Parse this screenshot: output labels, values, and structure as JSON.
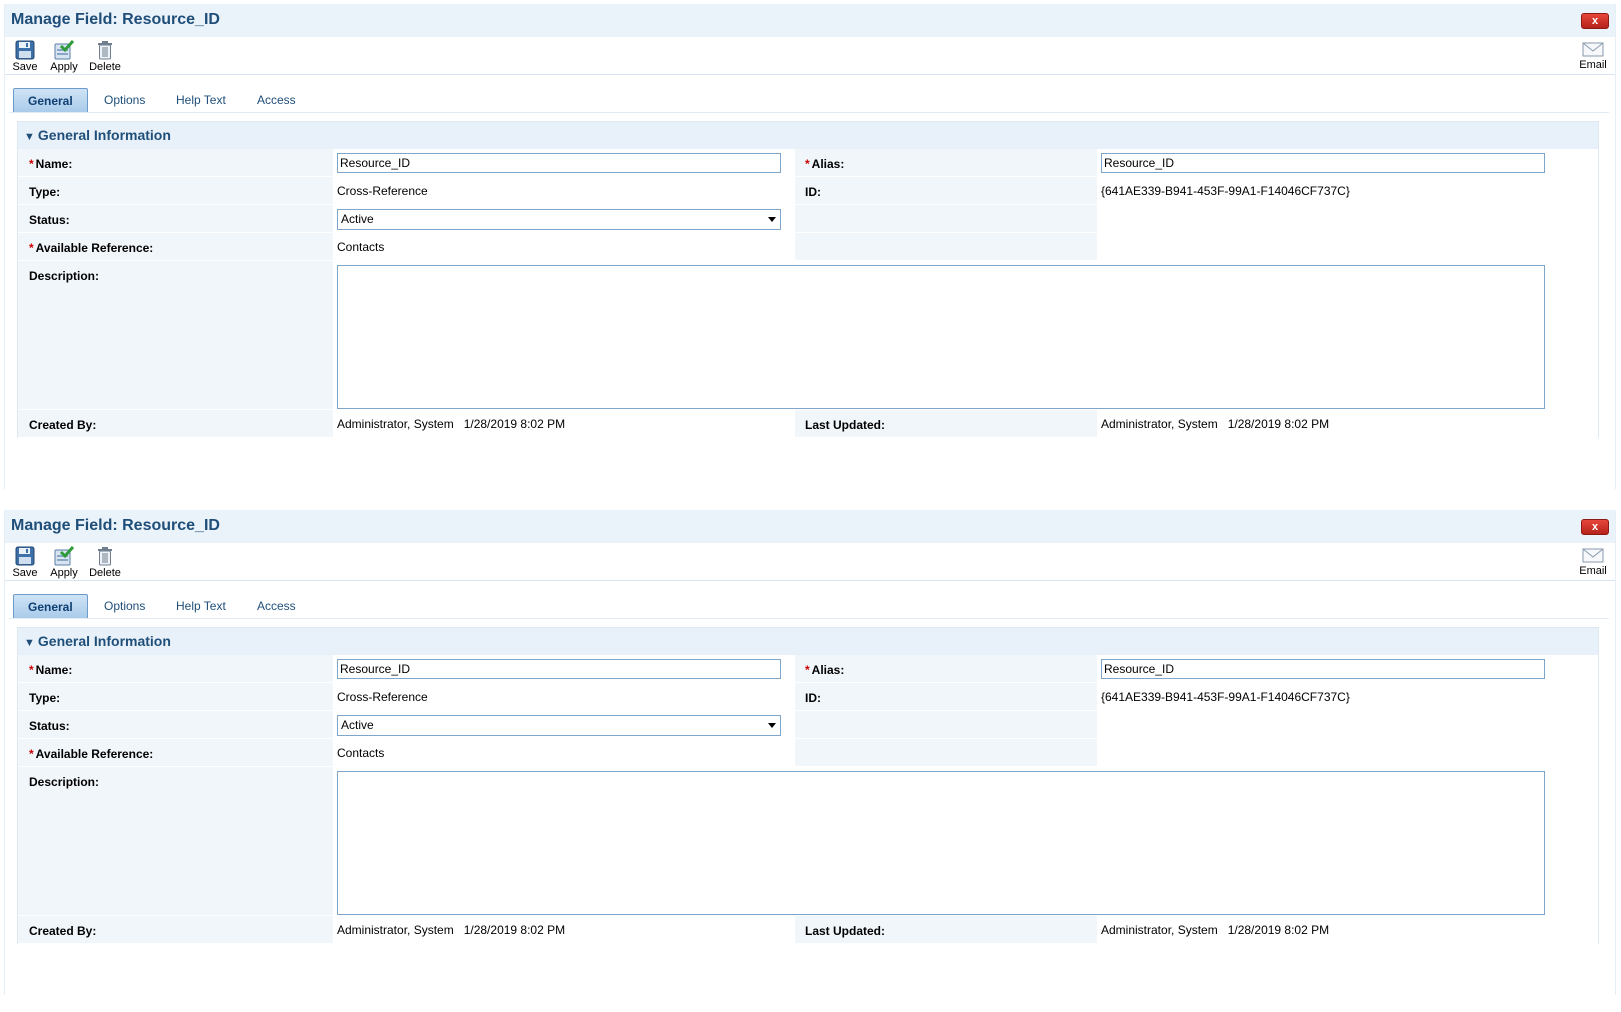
{
  "panels": [
    {
      "title": "Manage Field: Resource_ID",
      "close_label": "x",
      "toolbar": {
        "save": "Save",
        "apply": "Apply",
        "delete": "Delete",
        "email": "Email"
      },
      "tabs": [
        "General",
        "Options",
        "Help Text",
        "Access"
      ],
      "active_tab": "General",
      "section_title": "General Information",
      "fields": {
        "name_label": "Name:",
        "name_value": "Resource_ID",
        "alias_label": "Alias:",
        "alias_value": "Resource_ID",
        "type_label": "Type:",
        "type_value": "Cross-Reference",
        "id_label": "ID:",
        "id_value": "{641AE339-B941-453F-99A1-F14046CF737C}",
        "status_label": "Status:",
        "status_value": "Active",
        "available_reference_label": "Available Reference:",
        "available_reference_value": "Contacts",
        "description_label": "Description:",
        "description_value": "",
        "created_by_label": "Created By:",
        "created_by_value": "Administrator, System   1/28/2019 8:02 PM",
        "last_updated_label": "Last Updated:",
        "last_updated_value": "Administrator, System   1/28/2019 8:02 PM"
      }
    },
    {
      "title": "Manage Field: Resource_ID",
      "close_label": "x",
      "toolbar": {
        "save": "Save",
        "apply": "Apply",
        "delete": "Delete",
        "email": "Email"
      },
      "tabs": [
        "General",
        "Options",
        "Help Text",
        "Access"
      ],
      "active_tab": "General",
      "section_title": "General Information",
      "fields": {
        "name_label": "Name:",
        "name_value": "Resource_ID",
        "alias_label": "Alias:",
        "alias_value": "Resource_ID",
        "type_label": "Type:",
        "type_value": "Cross-Reference",
        "id_label": "ID:",
        "id_value": "{641AE339-B941-453F-99A1-F14046CF737C}",
        "status_label": "Status:",
        "status_value": "Active",
        "available_reference_label": "Available Reference:",
        "available_reference_value": "Contacts",
        "description_label": "Description:",
        "description_value": "",
        "created_by_label": "Created By:",
        "created_by_value": "Administrator, System   1/28/2019 8:02 PM",
        "last_updated_label": "Last Updated:",
        "last_updated_value": "Administrator, System   1/28/2019 8:02 PM"
      }
    }
  ],
  "colors": {
    "title": "#1f4e79",
    "header_bg": "#eaf2fa",
    "label_bg": "#f1f6fb",
    "required": "#cc0000",
    "input_border": "#7ea6cc"
  },
  "icons": {
    "save": "floppy-disk-icon",
    "apply": "apply-check-icon",
    "delete": "trash-can-icon",
    "email": "envelope-icon",
    "close": "close-icon",
    "collapse": "triangle-down-icon",
    "dropdown": "chevron-down-icon"
  }
}
